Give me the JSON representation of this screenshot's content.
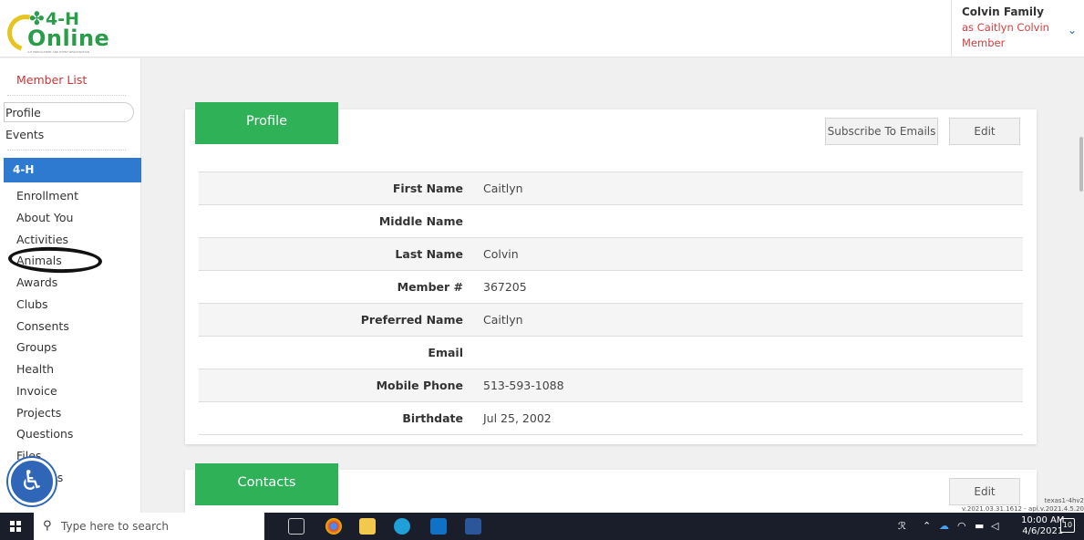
{
  "header": {
    "logo_top": "4-H",
    "logo_bottom": "Online",
    "logo_tagline": "4-H ENROLLMENT AND EVENT REGISTRATION",
    "family_name": "Colvin Family",
    "acting_as": "as Caitlyn Colvin",
    "role": "Member"
  },
  "sidebar": {
    "member_list": "Member List",
    "profile": "Profile",
    "events": "Events",
    "section": "4-H",
    "items": [
      "Enrollment",
      "About You",
      "Activities",
      "Animals",
      "Awards",
      "Clubs",
      "Consents",
      "Groups",
      "Health",
      "Invoice",
      "Projects",
      "Questions",
      "Files",
      "Settings"
    ]
  },
  "profile_card": {
    "title": "Profile",
    "subscribe_label": "Subscribe To Emails",
    "edit_label": "Edit",
    "fields": [
      {
        "label": "First Name",
        "value": "Caitlyn"
      },
      {
        "label": "Middle Name",
        "value": ""
      },
      {
        "label": "Last Name",
        "value": "Colvin"
      },
      {
        "label": "Member #",
        "value": "367205"
      },
      {
        "label": "Preferred Name",
        "value": "Caitlyn"
      },
      {
        "label": "Email",
        "value": ""
      },
      {
        "label": "Mobile Phone",
        "value": "513-593-1088"
      },
      {
        "label": "Birthdate",
        "value": "Jul 25, 2002"
      }
    ]
  },
  "contacts_card": {
    "title": "Contacts",
    "edit_label": "Edit"
  },
  "version": {
    "line1": "texas1-4hv2",
    "line2": "v.2021.03.31.1612 - api.v.2021.4.5.20"
  },
  "taskbar": {
    "search_placeholder": "Type here to search",
    "time": "10:00 AM",
    "date": "4/6/2021",
    "notifications": "10"
  },
  "colors": {
    "brand_green": "#2eb157",
    "active_blue": "#2e7ad1",
    "link_red": "#c93535"
  }
}
